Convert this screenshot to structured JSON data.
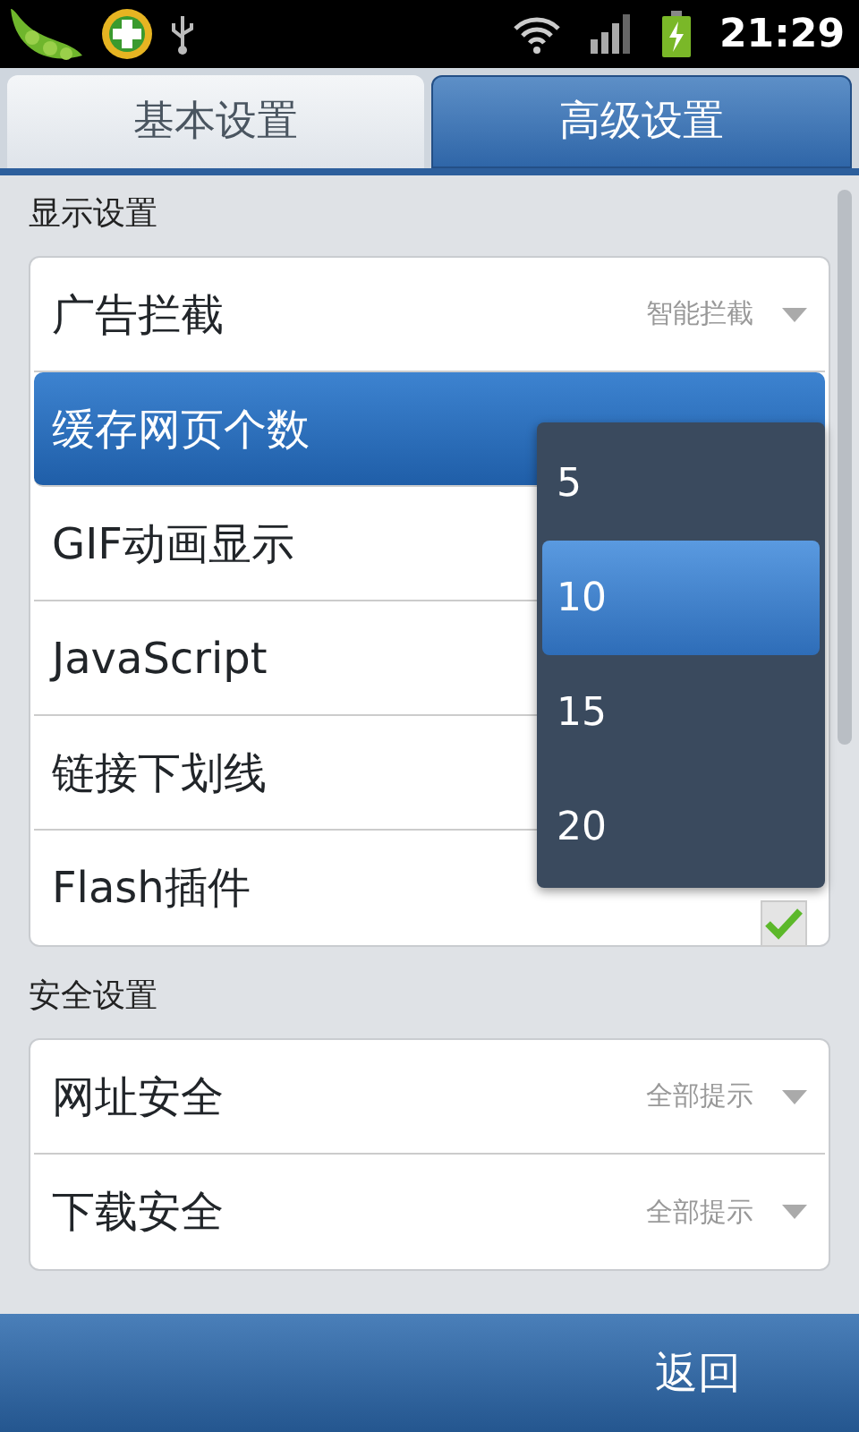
{
  "status_bar": {
    "time": "21:29"
  },
  "tabs": [
    {
      "label": "基本设置",
      "selected": false
    },
    {
      "label": "高级设置",
      "selected": true
    }
  ],
  "sections": [
    {
      "title": "显示设置",
      "rows": [
        {
          "kind": "select",
          "label": "广告拦截",
          "value": "智能拦截",
          "selected": false
        },
        {
          "kind": "select",
          "label": "缓存网页个数",
          "selected": true
        },
        {
          "kind": "plain",
          "label": "GIF动画显示",
          "selected": false
        },
        {
          "kind": "plain",
          "label": "JavaScript",
          "selected": false
        },
        {
          "kind": "plain",
          "label": "链接下划线",
          "selected": false
        },
        {
          "kind": "checkbox",
          "label": "Flash插件",
          "checked": true,
          "selected": false
        }
      ]
    },
    {
      "title": "安全设置",
      "rows": [
        {
          "kind": "select",
          "label": "网址安全",
          "value": "全部提示",
          "selected": false
        },
        {
          "kind": "select",
          "label": "下载安全",
          "value": "全部提示",
          "selected": false
        }
      ]
    }
  ],
  "popup": {
    "options": [
      {
        "label": "5",
        "selected": false
      },
      {
        "label": "10",
        "selected": true
      },
      {
        "label": "15",
        "selected": false
      },
      {
        "label": "20",
        "selected": false
      }
    ]
  },
  "bottom_bar": {
    "button": "返回"
  }
}
